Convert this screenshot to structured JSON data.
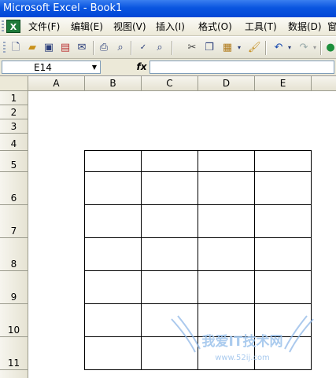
{
  "window": {
    "title": "Microsoft Excel - Book1"
  },
  "menu": {
    "app_icon": "excel-icon",
    "items": [
      {
        "label": "文件(F)"
      },
      {
        "label": "编辑(E)"
      },
      {
        "label": "视图(V)"
      },
      {
        "label": "插入(I)"
      },
      {
        "label": "格式(O)"
      },
      {
        "label": "工具(T)"
      },
      {
        "label": "数据(D)"
      },
      {
        "label": "窗"
      }
    ]
  },
  "toolbar": {
    "buttons": [
      "new-icon",
      "open-icon",
      "save-icon",
      "permission-icon",
      "email-icon",
      "print-icon",
      "print-preview-icon",
      "spelling-icon",
      "research-icon",
      "cut-icon",
      "copy-icon",
      "paste-icon",
      "format-painter-icon",
      "undo-icon",
      "redo-icon",
      "hyperlink-icon"
    ]
  },
  "formula_bar": {
    "name_box": "E14",
    "fx_label": "fx",
    "formula": ""
  },
  "sheet": {
    "columns": [
      "A",
      "B",
      "C",
      "D",
      "E"
    ],
    "rows": [
      "1",
      "2",
      "3",
      "4",
      "5",
      "6",
      "7",
      "8",
      "9",
      "10",
      "11"
    ]
  },
  "watermark": {
    "text": "我爱IT技术网",
    "url": "www.52ij.com"
  }
}
